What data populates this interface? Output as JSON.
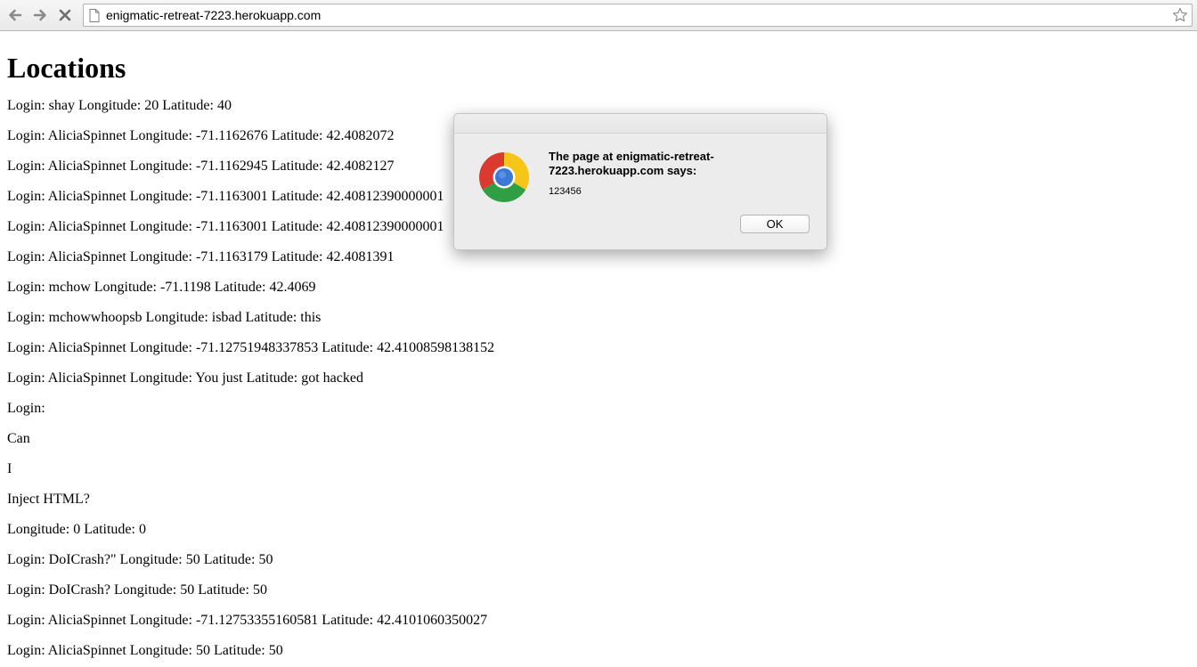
{
  "browser": {
    "url": "enigmatic-retreat-7223.herokuapp.com"
  },
  "page": {
    "heading": "Locations",
    "entries": [
      "Login: shay Longitude: 20 Latitude: 40",
      "Login: AliciaSpinnet Longitude: -71.1162676 Latitude: 42.4082072",
      "Login: AliciaSpinnet Longitude: -71.1162945 Latitude: 42.4082127",
      "Login: AliciaSpinnet Longitude: -71.1163001 Latitude: 42.40812390000001",
      "Login: AliciaSpinnet Longitude: -71.1163001 Latitude: 42.40812390000001",
      "Login: AliciaSpinnet Longitude: -71.1163179 Latitude: 42.4081391",
      "Login: mchow Longitude: -71.1198 Latitude: 42.4069",
      "Login: mchowwhoopsb Longitude: isbad Latitude: this",
      "Login: AliciaSpinnet Longitude: -71.12751948337853 Latitude: 42.41008598138152",
      "Login: AliciaSpinnet Longitude: You just Latitude: got hacked",
      "Login:",
      "Can",
      "I",
      "Inject HTML?",
      "Longitude: 0 Latitude: 0",
      "Login: DoICrash?\" Longitude: 50 Latitude: 50",
      "Login: DoICrash? Longitude: 50 Latitude: 50",
      "Login: AliciaSpinnet Longitude: -71.12753355160581 Latitude: 42.4101060350027",
      "Login: AliciaSpinnet Longitude: 50 Latitude: 50"
    ]
  },
  "dialog": {
    "title": "The page at enigmatic-retreat-7223.herokuapp.com says:",
    "message": "123456",
    "ok_label": "OK"
  }
}
